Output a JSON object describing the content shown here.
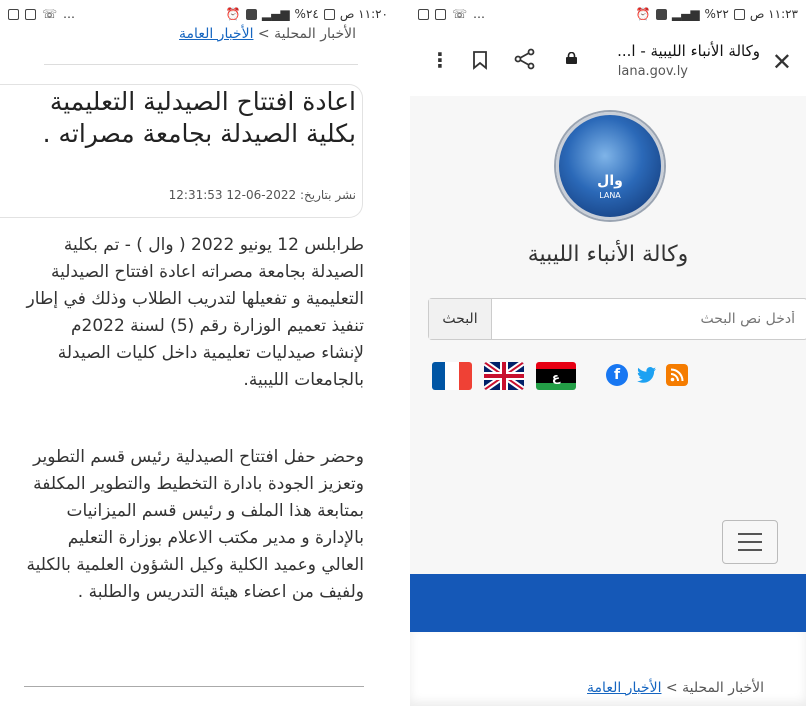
{
  "left": {
    "status": {
      "time": "١١:٢٠ ص",
      "battery": "%٢٤"
    },
    "breadcrumb": {
      "local": "الأخبار المحلية",
      "sep": ">",
      "general": "الأخبار العامة"
    },
    "headline": "اعادة افتتاح الصيدلية التعليمية بكلية الصيدلة بجامعة مصراته .",
    "published": "نشر بتاريخ: 2022-06-12 12:31:53",
    "paragraph1": "طرابلس 12 يونيو 2022 ( وال ) - تم بكلية الصيدلة بجامعة مصراته اعادة افتتاح الصيدلية التعليمية و تفعيلها لتدريب الطلاب وذلك في إطار تنفيذ تعميم الوزارة رقم (5) لسنة 2022م لإنشاء صيدليات تعليمية داخل كليات الصيدلة بالجامعات الليبية.",
    "paragraph2": "وحضر حفل افتتاح الصيدلية رئيس قسم التطوير وتعزيز الجودة بادارة التخطيط والتطوير المكلفة بمتابعة هذا الملف و رئيس قسم الميزانيات بالإدارة و مدير مكتب الاعلام بوزارة التعليم العالي وعميد الكلية وكيل الشؤون العلمية بالكلية ولفيف من اعضاء هيئة التدريس والطلبة ."
  },
  "right": {
    "status": {
      "time": "١١:٢٣ ص",
      "battery": "%٢٢"
    },
    "browser": {
      "title": "وكالة الأنباء الليبية - ا...",
      "url": "lana.gov.ly"
    },
    "logo": {
      "arabic": "وال",
      "latin": "LANA"
    },
    "agency_name": "وكالة الأنباء الليبية",
    "search": {
      "placeholder": "أدخل نص البحث",
      "button": "البحث"
    },
    "breadcrumb": {
      "local": "الأخبار المحلية",
      "sep": ">",
      "general": "الأخبار العامة"
    },
    "colors": {
      "nav": "#1558b7",
      "rss": "#f57c00",
      "twitter": "#1da1f2",
      "facebook": "#1877f2"
    }
  }
}
